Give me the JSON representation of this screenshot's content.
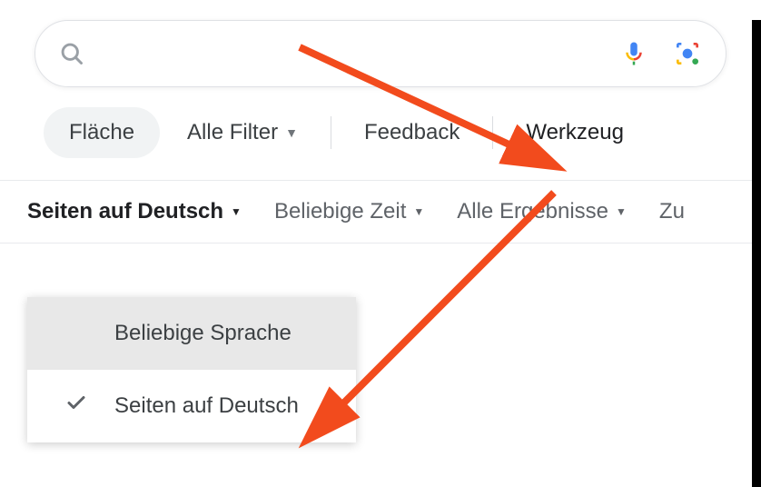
{
  "search": {
    "placeholder": ""
  },
  "filters": {
    "area": "Fläche",
    "all_filters": "Alle Filter",
    "feedback": "Feedback",
    "tools": "Werkzeug"
  },
  "tools": {
    "language": "Seiten auf Deutsch",
    "time": "Beliebige Zeit",
    "results": "Alle Ergebnisse",
    "reset_partial": "Zu"
  },
  "dropdown": {
    "any_language": "Beliebige Sprache",
    "pages_german": "Seiten auf Deutsch"
  }
}
